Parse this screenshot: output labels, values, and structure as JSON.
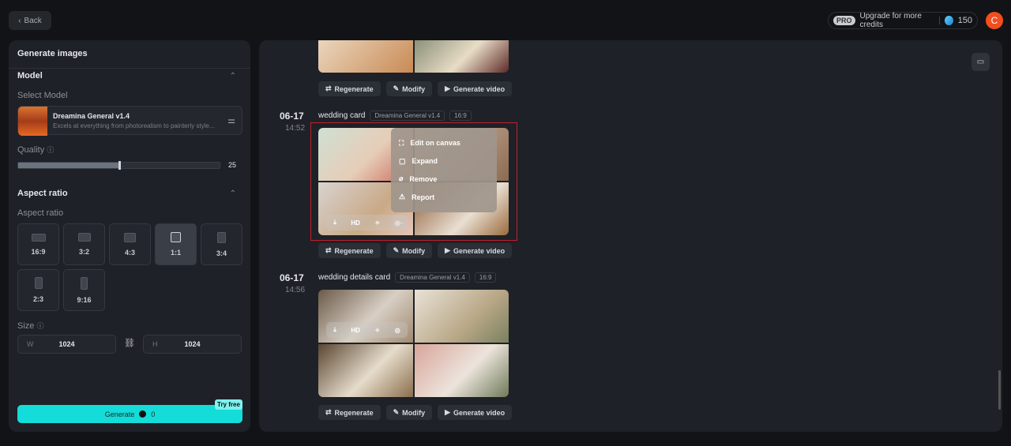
{
  "header": {
    "back_label": "Back",
    "pro_badge": "PRO",
    "upgrade_label": "Upgrade for more credits",
    "credits": "150",
    "avatar_letter": "C"
  },
  "left_panel": {
    "title": "Generate images",
    "model_section": "Model",
    "select_model_label": "Select Model",
    "model": {
      "name": "Dreamina General v1.4",
      "description": "Excels at everything from photorealism to painterly style..."
    },
    "quality_label": "Quality",
    "quality_value": "25",
    "quality_fraction": 0.5,
    "aspect_section": "Aspect ratio",
    "aspect_label": "Aspect ratio",
    "aspect_options": [
      "16:9",
      "3:2",
      "4:3",
      "1:1",
      "3:4",
      "2:3",
      "9:16"
    ],
    "aspect_selected": "1:1",
    "size_label": "Size",
    "width_key": "W",
    "width": "1024",
    "height_key": "H",
    "height": "1024",
    "generate_label": "Generate",
    "generate_cost": "0",
    "try_free": "Try free"
  },
  "feed": {
    "actions": {
      "regenerate": "Regenerate",
      "modify": "Modify",
      "generate_video": "Generate video"
    },
    "groups": [
      {
        "date": "06-17",
        "time": "14:52",
        "title": "wedding card",
        "model": "Dreamina General v1.4",
        "ratio": "16:9"
      },
      {
        "date": "06-17",
        "time": "14:56",
        "title": "wedding details card",
        "model": "Dreamina General v1.4",
        "ratio": "16:9"
      }
    ],
    "image_toolbar": {
      "hd": "HD",
      "more": "···"
    },
    "context_menu": [
      "Edit on canvas",
      "Expand",
      "Remove",
      "Report"
    ]
  },
  "colors": {
    "accent": "#14dcd8",
    "avatar": "#f24e1e",
    "highlight_border": "#c0202a"
  }
}
